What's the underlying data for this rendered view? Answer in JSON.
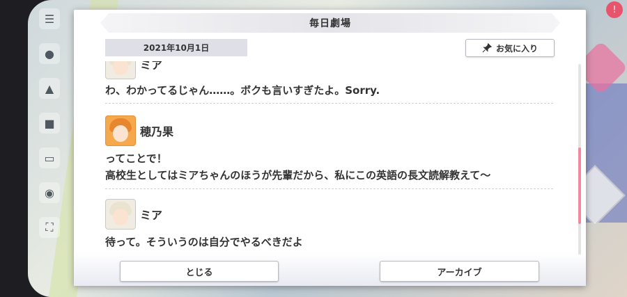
{
  "dialog": {
    "title": "毎日劇場",
    "date": "2021年10月1日",
    "favorite_label": "お気に入り",
    "close_label": "とじる",
    "archive_label": "アーカイブ"
  },
  "log": [
    {
      "speaker": "ミア",
      "line1": "わ、わかってるじゃん……。ボクも言いすぎたよ。Sorry.",
      "line2": ""
    },
    {
      "speaker": "穂乃果",
      "line1": "ってことで！",
      "line2": "高校生としてはミアちゃんのほうが先輩だから、私にこの英語の長文読解教えて〜"
    },
    {
      "speaker": "ミア",
      "line1": "待って。そういうのは自分でやるべきだよ",
      "line2": ""
    }
  ],
  "icons": {
    "favorite": "pin-icon",
    "menu": "hamburger-icon"
  },
  "colors": {
    "accent": "#f08aa0",
    "header_bg": "#e4e4e9",
    "date_chip": "#dfe0e7"
  }
}
